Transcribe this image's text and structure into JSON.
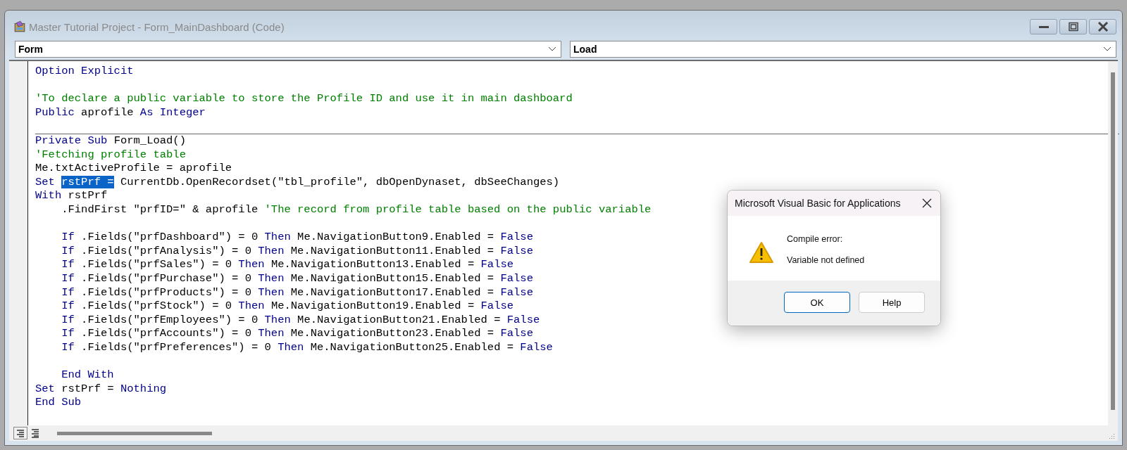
{
  "window": {
    "title": "Master Tutorial Project - Form_MainDashboard (Code)"
  },
  "object_combo": {
    "value": "Form"
  },
  "procedure_combo": {
    "value": "Load"
  },
  "procedures": [
    {
      "lines": [
        {
          "segments": [
            {
              "kind": "keyword",
              "text": "Option Explicit"
            }
          ]
        },
        {
          "gap_before": true,
          "segments": [
            {
              "kind": "comment",
              "text": "'To declare a public variable to store the Profile ID and use it in main dashboard"
            }
          ]
        },
        {
          "segments": [
            {
              "kind": "keyword",
              "text": "Public"
            },
            {
              "kind": "plain",
              "text": " aprofile "
            },
            {
              "kind": "keyword",
              "text": "As Integer"
            }
          ]
        }
      ]
    },
    {
      "lines": [
        {
          "segments": [
            {
              "kind": "keyword",
              "text": "Private Sub"
            },
            {
              "kind": "plain",
              "text": " Form_Load()"
            }
          ]
        },
        {
          "segments": [
            {
              "kind": "comment",
              "text": "'Fetching profile table"
            }
          ]
        },
        {
          "segments": [
            {
              "kind": "plain",
              "text": "Me.txtActiveProfile = aprofile"
            }
          ]
        },
        {
          "segments": [
            {
              "kind": "keyword",
              "text": "Set "
            },
            {
              "kind": "selected",
              "text": "rstPrf ="
            },
            {
              "kind": "plain",
              "text": " CurrentDb.OpenRecordset(\"tbl_profile\", dbOpenDynaset, dbSeeChanges)"
            }
          ]
        },
        {
          "segments": [
            {
              "kind": "keyword",
              "text": "With"
            },
            {
              "kind": "plain",
              "text": " rstPrf"
            }
          ]
        },
        {
          "indented": true,
          "segments": [
            {
              "kind": "plain",
              "text": ".FindFirst \"prfID=\" & aprofile "
            },
            {
              "kind": "comment",
              "text": "'The record from profile table based on the public variable"
            }
          ]
        },
        {
          "indented": true,
          "gap_before": true,
          "segments": [
            {
              "kind": "keyword",
              "text": "If"
            },
            {
              "kind": "plain",
              "text": " .Fields(\"prfDashboard\") = 0 "
            },
            {
              "kind": "keyword",
              "text": "Then"
            },
            {
              "kind": "plain",
              "text": " Me.NavigationButton9.Enabled = "
            },
            {
              "kind": "keyword",
              "text": "False"
            }
          ]
        },
        {
          "indented": true,
          "segments": [
            {
              "kind": "keyword",
              "text": "If"
            },
            {
              "kind": "plain",
              "text": " .Fields(\"prfAnalysis\") = 0 "
            },
            {
              "kind": "keyword",
              "text": "Then"
            },
            {
              "kind": "plain",
              "text": " Me.NavigationButton11.Enabled = "
            },
            {
              "kind": "keyword",
              "text": "False"
            }
          ]
        },
        {
          "indented": true,
          "segments": [
            {
              "kind": "keyword",
              "text": "If"
            },
            {
              "kind": "plain",
              "text": " .Fields(\"prfSales\") = 0 "
            },
            {
              "kind": "keyword",
              "text": "Then"
            },
            {
              "kind": "plain",
              "text": " Me.NavigationButton13.Enabled = "
            },
            {
              "kind": "keyword",
              "text": "False"
            }
          ]
        },
        {
          "indented": true,
          "segments": [
            {
              "kind": "keyword",
              "text": "If"
            },
            {
              "kind": "plain",
              "text": " .Fields(\"prfPurchase\") = 0 "
            },
            {
              "kind": "keyword",
              "text": "Then"
            },
            {
              "kind": "plain",
              "text": " Me.NavigationButton15.Enabled = "
            },
            {
              "kind": "keyword",
              "text": "False"
            }
          ]
        },
        {
          "indented": true,
          "segments": [
            {
              "kind": "keyword",
              "text": "If"
            },
            {
              "kind": "plain",
              "text": " .Fields(\"prfProducts\") = 0 "
            },
            {
              "kind": "keyword",
              "text": "Then"
            },
            {
              "kind": "plain",
              "text": " Me.NavigationButton17.Enabled = "
            },
            {
              "kind": "keyword",
              "text": "False"
            }
          ]
        },
        {
          "indented": true,
          "segments": [
            {
              "kind": "keyword",
              "text": "If"
            },
            {
              "kind": "plain",
              "text": " .Fields(\"prfStock\") = 0 "
            },
            {
              "kind": "keyword",
              "text": "Then"
            },
            {
              "kind": "plain",
              "text": " Me.NavigationButton19.Enabled = "
            },
            {
              "kind": "keyword",
              "text": "False"
            }
          ]
        },
        {
          "indented": true,
          "segments": [
            {
              "kind": "keyword",
              "text": "If"
            },
            {
              "kind": "plain",
              "text": " .Fields(\"prfEmployees\") = 0 "
            },
            {
              "kind": "keyword",
              "text": "Then"
            },
            {
              "kind": "plain",
              "text": " Me.NavigationButton21.Enabled = "
            },
            {
              "kind": "keyword",
              "text": "False"
            }
          ]
        },
        {
          "indented": true,
          "segments": [
            {
              "kind": "keyword",
              "text": "If"
            },
            {
              "kind": "plain",
              "text": " .Fields(\"prfAccounts\") = 0 "
            },
            {
              "kind": "keyword",
              "text": "Then"
            },
            {
              "kind": "plain",
              "text": " Me.NavigationButton23.Enabled = "
            },
            {
              "kind": "keyword",
              "text": "False"
            }
          ]
        },
        {
          "indented": true,
          "segments": [
            {
              "kind": "keyword",
              "text": "If"
            },
            {
              "kind": "plain",
              "text": " .Fields(\"prfPreferences\") = 0 "
            },
            {
              "kind": "keyword",
              "text": "Then"
            },
            {
              "kind": "plain",
              "text": " Me.NavigationButton25.Enabled = "
            },
            {
              "kind": "keyword",
              "text": "False"
            }
          ]
        },
        {
          "indented": true,
          "gap_before": true,
          "segments": [
            {
              "kind": "keyword",
              "text": "End With"
            }
          ]
        },
        {
          "segments": [
            {
              "kind": "keyword",
              "text": "Set"
            },
            {
              "kind": "plain",
              "text": " rstPrf = "
            },
            {
              "kind": "keyword",
              "text": "Nothing"
            }
          ]
        },
        {
          "segments": [
            {
              "kind": "keyword",
              "text": "End Sub"
            }
          ]
        }
      ]
    }
  ],
  "dialog": {
    "title": "Microsoft Visual Basic for Applications",
    "heading": "Compile error:",
    "message": "Variable not defined",
    "buttons": [
      {
        "label": "OK",
        "selected": true
      },
      {
        "label": "Help",
        "selected": false
      }
    ]
  }
}
